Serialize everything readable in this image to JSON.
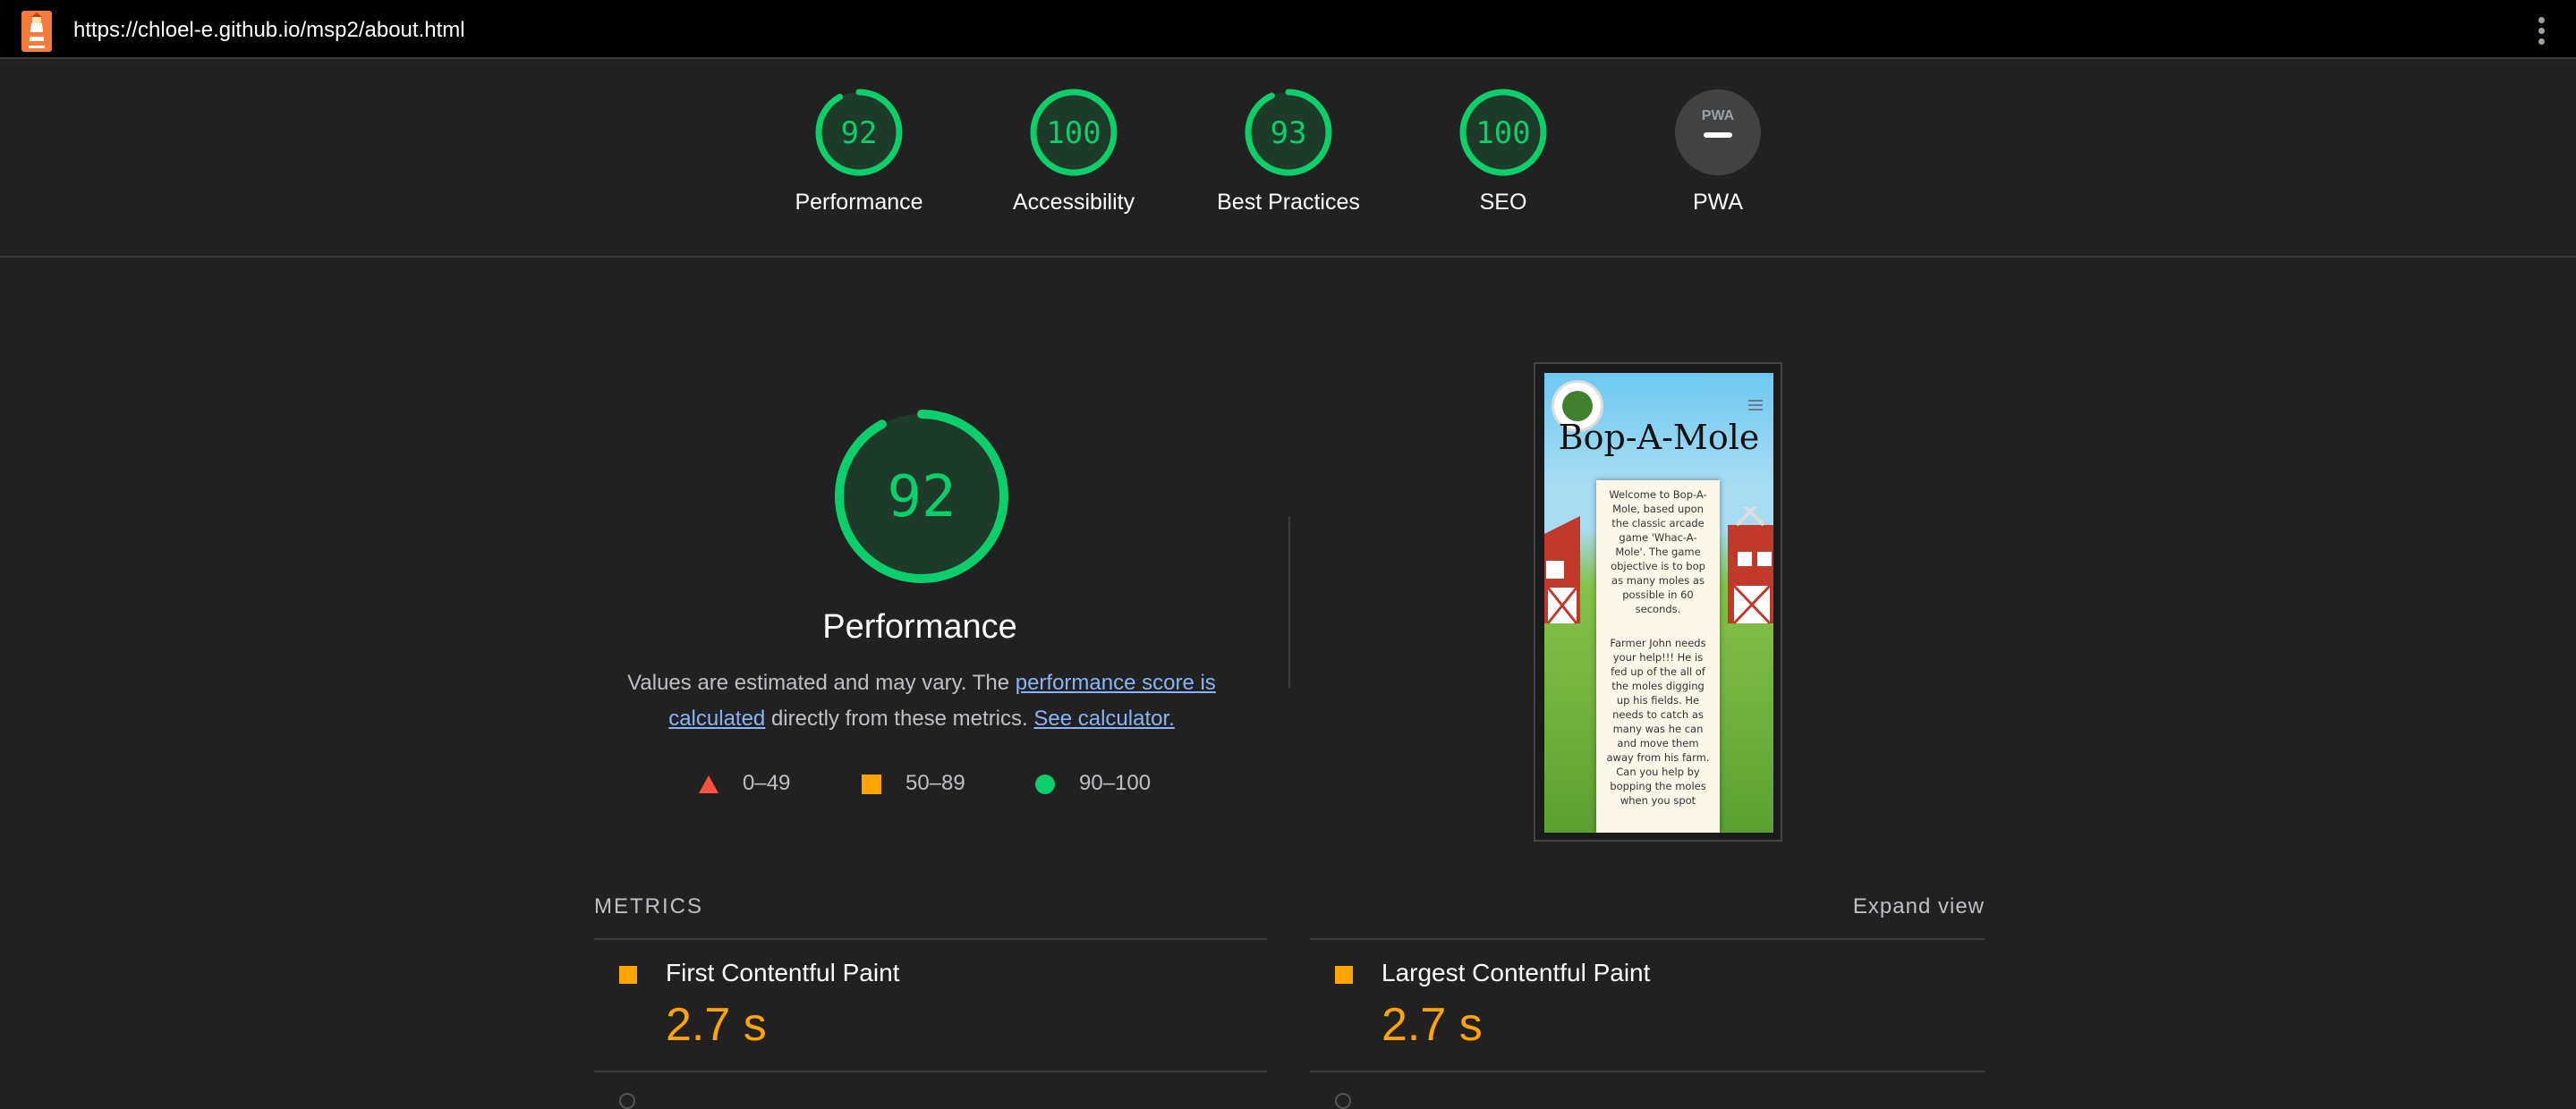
{
  "browser": {
    "url": "https://chloel-e.github.io/msp2/about.html"
  },
  "colors": {
    "pass": "#0cce6b",
    "average": "#ffa400",
    "fail": "#ff4e42",
    "background": "#212121"
  },
  "categories": [
    {
      "score": "92",
      "label": "Performance"
    },
    {
      "score": "100",
      "label": "Accessibility"
    },
    {
      "score": "93",
      "label": "Best Practices"
    },
    {
      "score": "100",
      "label": "SEO"
    },
    {
      "score": "PWA",
      "label": "PWA"
    }
  ],
  "performance": {
    "score": "92",
    "title": "Performance",
    "desc_prefix": "Values are estimated and may vary. The ",
    "desc_link1": "performance score is calculated",
    "desc_middle": " directly from these metrics. ",
    "desc_link2": "See calculator.",
    "legend": [
      {
        "shape": "triangle",
        "range": "0–49"
      },
      {
        "shape": "square",
        "range": "50–89"
      },
      {
        "shape": "circle",
        "range": "90–100"
      }
    ]
  },
  "screenshot": {
    "title": "Bop-A-Mole",
    "paragraph1": "Welcome to Bop-A-Mole, based upon the classic arcade game 'Whac-A-Mole'. The game objective is to bop as many moles as possible in 60 seconds.",
    "paragraph2": "Farmer John needs your help!!! He is fed up of the all of the moles digging up his fields. He needs to catch as many was he can and move them away from his farm. Can you help by bopping the moles when you spot"
  },
  "metrics": {
    "heading": "METRICS",
    "expand": "Expand view",
    "items": [
      {
        "name": "First Contentful Paint",
        "value": "2.7 s",
        "status": "average"
      },
      {
        "name": "Largest Contentful Paint",
        "value": "2.7 s",
        "status": "average"
      }
    ]
  }
}
